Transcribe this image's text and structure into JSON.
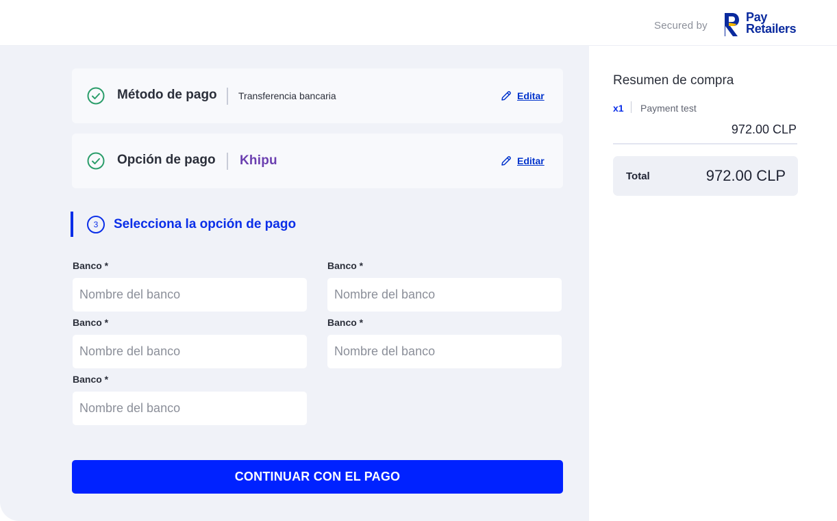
{
  "header": {
    "secured_by": "Secured by",
    "brand_line1": "Pay",
    "brand_line2": "Retailers",
    "brand_color": "#0a2a9e",
    "brand_accent": "#f5b800"
  },
  "steps": [
    {
      "title": "Método de pago",
      "value": "Transferencia bancaria",
      "edit_label": "Editar",
      "status_icon": "check-circle-icon"
    },
    {
      "title": "Opción de pago",
      "value": "Khipu",
      "edit_label": "Editar",
      "status_icon": "check-circle-icon"
    }
  ],
  "section": {
    "number": "3",
    "title": "Selecciona la opción de pago"
  },
  "bank_fields": [
    {
      "label": "Banco *",
      "placeholder": "Nombre del banco",
      "value": ""
    },
    {
      "label": "Banco *",
      "placeholder": "Nombre del banco",
      "value": ""
    },
    {
      "label": "Banco *",
      "placeholder": "Nombre del banco",
      "value": ""
    },
    {
      "label": "Banco *",
      "placeholder": "Nombre del banco",
      "value": ""
    },
    {
      "label": "Banco *",
      "placeholder": "Nombre del banco",
      "value": ""
    }
  ],
  "continue_label": "CONTINUAR CON EL PAGO",
  "summary": {
    "title": "Resumen de compra",
    "quantity": "x1",
    "item_name": "Payment test",
    "item_price": "972.00 CLP",
    "total_label": "Total",
    "total_value": "972.00 CLP"
  },
  "colors": {
    "primary": "#0022ff",
    "accent_blue": "#0a2ee8",
    "success": "#2a9d6a",
    "khipu": "#6b3fb0",
    "panel_bg": "#f0f2f8"
  }
}
